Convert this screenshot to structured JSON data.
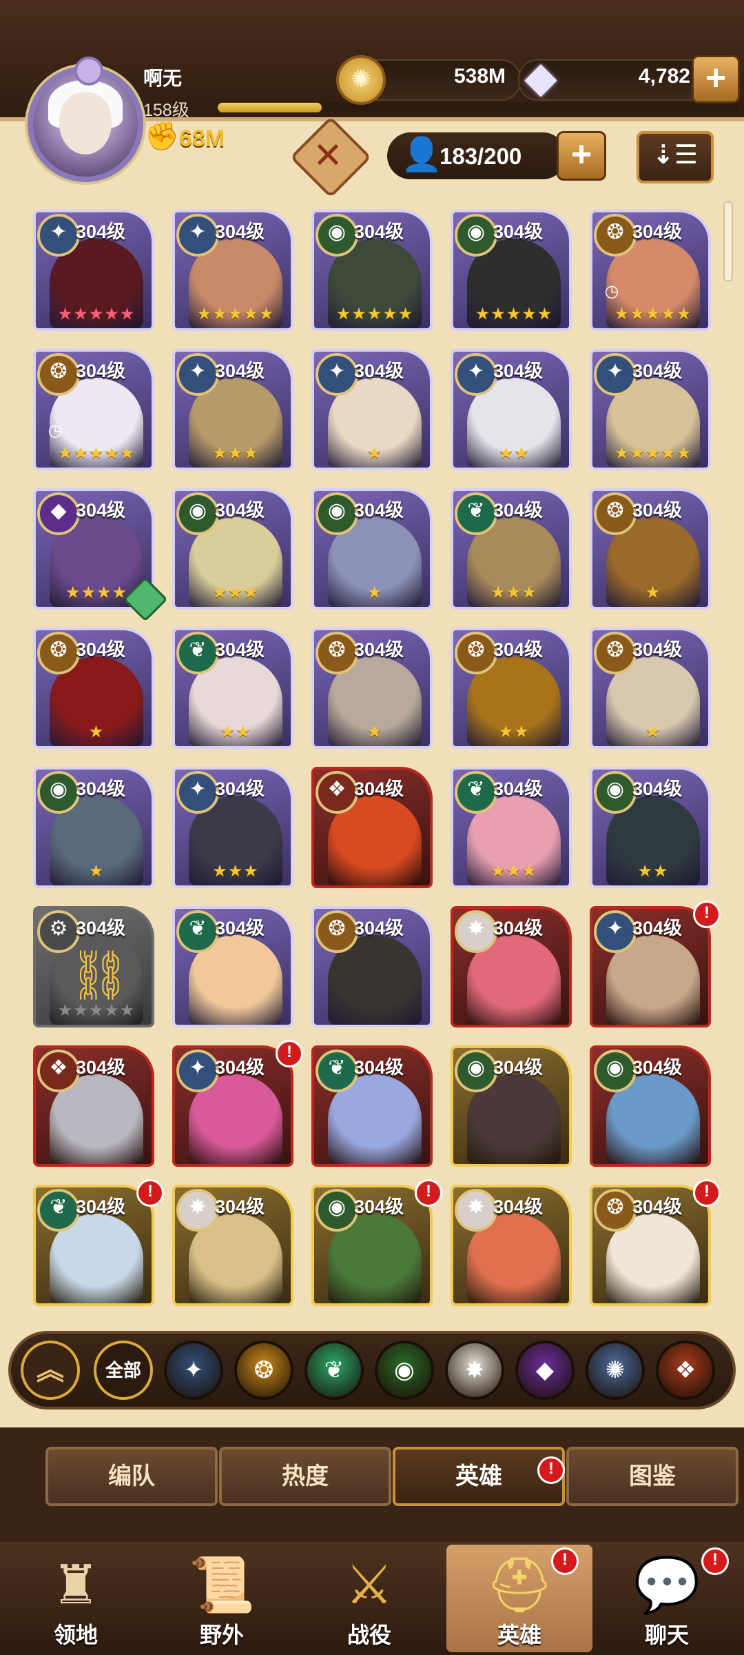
{
  "player": {
    "name": "啊无",
    "level": "158级",
    "power": "68M",
    "xp_progress": 0.2
  },
  "resources": {
    "gold": "538M",
    "gems": "4,782"
  },
  "hero_count": "183/200",
  "heroes": [
    {
      "level": "304级",
      "faction": "celestial",
      "stars": "★★★★★",
      "star_style": "pink",
      "frame": "normal",
      "color": "#5a1a22"
    },
    {
      "level": "304级",
      "faction": "celestial",
      "stars": "★★★★★",
      "star_style": "gold",
      "frame": "normal",
      "color": "#c98a6a"
    },
    {
      "level": "304级",
      "faction": "wilder",
      "stars": "★★★★★",
      "star_style": "gold",
      "frame": "normal",
      "color": "#3d4a3a"
    },
    {
      "level": "304级",
      "faction": "wilder",
      "stars": "★★★★★",
      "star_style": "gold",
      "frame": "normal",
      "color": "#2c2f2c"
    },
    {
      "level": "304级",
      "faction": "lightbearer",
      "stars": "★★★★★",
      "star_style": "gold",
      "frame": "normal",
      "color": "#d58a6a",
      "clock": true
    },
    {
      "level": "304级",
      "faction": "lightbearer",
      "stars": "★★★★★",
      "star_style": "gold",
      "frame": "normal",
      "color": "#ede8f2",
      "clock": true
    },
    {
      "level": "304级",
      "faction": "celestial",
      "stars": "★★★",
      "star_style": "gold",
      "frame": "normal",
      "color": "#b79a6a"
    },
    {
      "level": "304级",
      "faction": "celestial",
      "stars": "★",
      "star_style": "gold",
      "frame": "normal",
      "color": "#e9d8c4"
    },
    {
      "level": "304级",
      "faction": "celestial",
      "stars": "★★",
      "star_style": "gold",
      "frame": "normal",
      "color": "#e6e4ea"
    },
    {
      "level": "304级",
      "faction": "celestial",
      "stars": "★★★★★",
      "star_style": "gold",
      "frame": "normal",
      "color": "#d8c29a"
    },
    {
      "level": "304级",
      "faction": "hypogean",
      "stars": "★★★★",
      "star_style": "gold",
      "frame": "normal",
      "color": "#6a4a8a",
      "hourglass": true
    },
    {
      "level": "304级",
      "faction": "wilder",
      "stars": "★★★",
      "star_style": "gold",
      "frame": "normal",
      "color": "#d9ce9a"
    },
    {
      "level": "304级",
      "faction": "wilder",
      "stars": "★",
      "star_style": "gold",
      "frame": "normal",
      "color": "#8c92b8"
    },
    {
      "level": "304级",
      "faction": "mauler",
      "stars": "★★★",
      "star_style": "gold",
      "frame": "normal",
      "color": "#a98a5a"
    },
    {
      "level": "304级",
      "faction": "lightbearer",
      "stars": "★",
      "star_style": "gold",
      "frame": "normal",
      "color": "#9a6a2a"
    },
    {
      "level": "304级",
      "faction": "lightbearer",
      "stars": "★",
      "star_style": "gold",
      "frame": "normal",
      "color": "#8a1a1a"
    },
    {
      "level": "304级",
      "faction": "mauler",
      "stars": "★★",
      "star_style": "gold",
      "frame": "normal",
      "color": "#e8d8d8"
    },
    {
      "level": "304级",
      "faction": "lightbearer",
      "stars": "★",
      "star_style": "gold",
      "frame": "normal",
      "color": "#b8aa9a"
    },
    {
      "level": "304级",
      "faction": "lightbearer",
      "stars": "★★",
      "star_style": "gold",
      "frame": "normal",
      "color": "#a8741a"
    },
    {
      "level": "304级",
      "faction": "lightbearer",
      "stars": "★",
      "star_style": "gold",
      "frame": "normal",
      "color": "#d8c8b0"
    },
    {
      "level": "304级",
      "faction": "wilder",
      "stars": "★",
      "star_style": "gold",
      "frame": "normal",
      "color": "#5a6a7a"
    },
    {
      "level": "304级",
      "faction": "celestial",
      "stars": "★★★",
      "star_style": "gold",
      "frame": "normal",
      "color": "#3a3a48"
    },
    {
      "level": "304级",
      "faction": "graveborn",
      "stars": "",
      "star_style": "gold",
      "frame": "red",
      "color": "#d84a22"
    },
    {
      "level": "304级",
      "faction": "mauler",
      "stars": "★★★",
      "star_style": "gold",
      "frame": "normal",
      "color": "#e8a0b0"
    },
    {
      "level": "304级",
      "faction": "wilder",
      "stars": "★★",
      "star_style": "gold",
      "frame": "normal",
      "color": "#2e3a40"
    },
    {
      "level": "304级",
      "faction": "locked",
      "stars": "★★★★★",
      "star_style": "grey",
      "frame": "locked",
      "color": "#5a5a5a",
      "chain": true
    },
    {
      "level": "304级",
      "faction": "mauler",
      "stars": "",
      "star_style": "gold",
      "frame": "normal",
      "color": "#f0c89a"
    },
    {
      "level": "304级",
      "faction": "lightbearer",
      "stars": "",
      "star_style": "gold",
      "frame": "normal",
      "color": "#3a3430"
    },
    {
      "level": "304级",
      "faction": "dimensional",
      "stars": "",
      "star_style": "gold",
      "frame": "red",
      "color": "#e06a7a"
    },
    {
      "level": "304级",
      "faction": "celestial",
      "stars": "",
      "star_style": "gold",
      "frame": "red",
      "color": "#c8a88a",
      "alert": true
    },
    {
      "level": "304级",
      "faction": "graveborn",
      "stars": "",
      "star_style": "gold",
      "frame": "red",
      "color": "#b8b8c0"
    },
    {
      "level": "304级",
      "faction": "celestial",
      "stars": "",
      "star_style": "gold",
      "frame": "red",
      "color": "#d85a9a",
      "alert": true
    },
    {
      "level": "304级",
      "faction": "mauler",
      "stars": "",
      "star_style": "gold",
      "frame": "red",
      "color": "#9aa8e0"
    },
    {
      "level": "304级",
      "faction": "wilder",
      "stars": "",
      "star_style": "gold",
      "frame": "gold",
      "color": "#4a3a3a"
    },
    {
      "level": "304级",
      "faction": "wilder",
      "stars": "",
      "star_style": "gold",
      "frame": "red",
      "color": "#6a9ac8"
    },
    {
      "level": "304级",
      "faction": "mauler",
      "stars": "",
      "star_style": "gold",
      "frame": "gold",
      "color": "#c8d8e8",
      "alert": true
    },
    {
      "level": "304级",
      "faction": "dimensional",
      "stars": "",
      "star_style": "gold",
      "frame": "gold",
      "color": "#d8c088"
    },
    {
      "level": "304级",
      "faction": "wilder",
      "stars": "",
      "star_style": "gold",
      "frame": "gold",
      "color": "#4a7a3a",
      "alert": true
    },
    {
      "level": "304级",
      "faction": "dimensional",
      "stars": "",
      "star_style": "gold",
      "frame": "gold",
      "color": "#e07050"
    },
    {
      "level": "304级",
      "faction": "lightbearer",
      "stars": "",
      "star_style": "gold",
      "frame": "gold",
      "color": "#efe6d8",
      "alert": true
    }
  ],
  "faction_colors": {
    "celestial": "#33507a",
    "wilder": "#2e5a2e",
    "lightbearer": "#8a5a1a",
    "mauler": "#1e6a4a",
    "hypogean": "#5a2e8a",
    "graveborn": "#7a2a1a",
    "dimensional": "#d8d0c8",
    "locked": "#4a4a4a"
  },
  "filters": {
    "all_label": "全部",
    "items": [
      {
        "name": "celestial",
        "glyph": "✦",
        "color": "#33507a"
      },
      {
        "name": "lightbearer",
        "glyph": "❂",
        "color": "#c88a1a"
      },
      {
        "name": "mauler",
        "glyph": "❦",
        "color": "#2aa86a"
      },
      {
        "name": "wilder",
        "glyph": "◉",
        "color": "#2a6a2a"
      },
      {
        "name": "dimensional",
        "glyph": "✸",
        "color": "#e8e0d8"
      },
      {
        "name": "hypogean",
        "glyph": "◆",
        "color": "#6a2e9a"
      },
      {
        "name": "graveborn-alt",
        "glyph": "✺",
        "color": "#4a6a9a"
      },
      {
        "name": "graveborn",
        "glyph": "❖",
        "color": "#a83a1a"
      }
    ]
  },
  "subtabs": [
    "编队",
    "热度",
    "英雄",
    "图鉴"
  ],
  "nav": [
    "领地",
    "野外",
    "战役",
    "英雄",
    "聊天"
  ]
}
